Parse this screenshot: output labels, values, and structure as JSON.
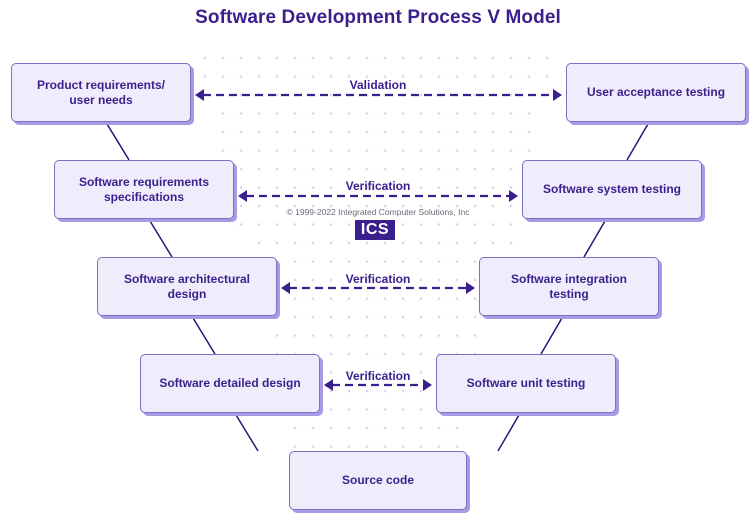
{
  "title": "Software Development Process V Model",
  "colors": {
    "primary": "#3b1f8c",
    "box_fill": "#efedfc",
    "box_border": "#7d6fc4",
    "box_shadow": "#a89be3",
    "dots": "#d9d6ee"
  },
  "left_boxes": [
    {
      "label": "Product requirements/\nuser needs"
    },
    {
      "label": "Software requirements\nspecifications"
    },
    {
      "label": "Software architectural design"
    },
    {
      "label": "Software detailed design"
    }
  ],
  "right_boxes": [
    {
      "label": "User acceptance testing"
    },
    {
      "label": "Software system testing"
    },
    {
      "label": "Software integration testing"
    },
    {
      "label": "Software unit testing"
    }
  ],
  "bottom_box": {
    "label": "Source code"
  },
  "links": [
    {
      "label": "Validation"
    },
    {
      "label": "Verification"
    },
    {
      "label": "Verification"
    },
    {
      "label": "Verification"
    }
  ],
  "watermark": {
    "copyright": "© 1999-2022 Integrated Computer Solutions, Inc",
    "logo_text": "ICS"
  }
}
